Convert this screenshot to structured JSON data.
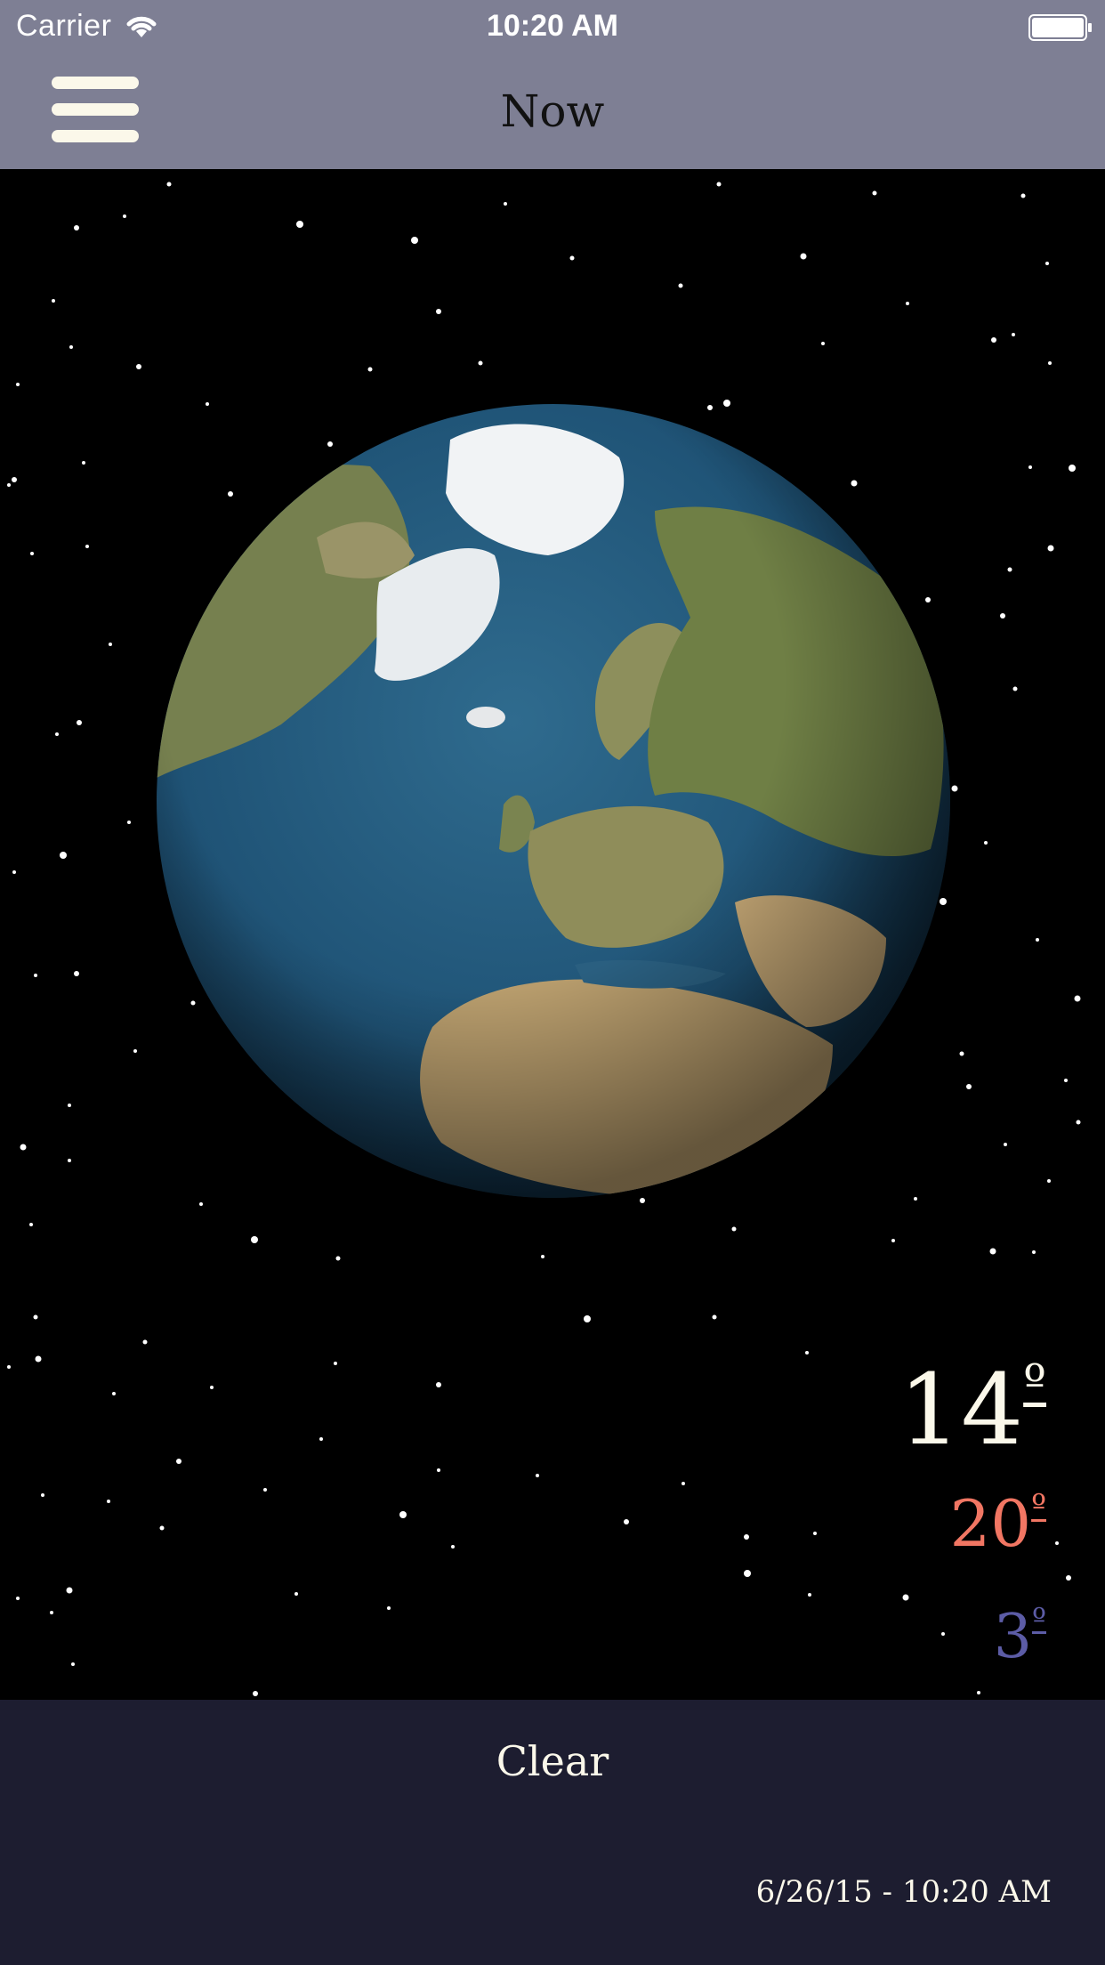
{
  "status_bar": {
    "carrier": "Carrier",
    "time": "10:20 AM",
    "wifi_icon": "wifi-icon",
    "battery_icon": "battery-icon"
  },
  "nav": {
    "title": "Now",
    "menu_icon": "hamburger-menu-icon"
  },
  "weather": {
    "current_temp": "14",
    "high_temp": "20",
    "low_temp": "3",
    "degree_symbol": "º",
    "condition": "Clear",
    "timestamp": "6/26/15 - 10:20 AM"
  },
  "colors": {
    "header": "#7e7f94",
    "bottom_panel": "#1d1d30",
    "current_temp": "#fbf8ea",
    "high_temp": "#f17663",
    "low_temp": "#5c5ca6"
  }
}
